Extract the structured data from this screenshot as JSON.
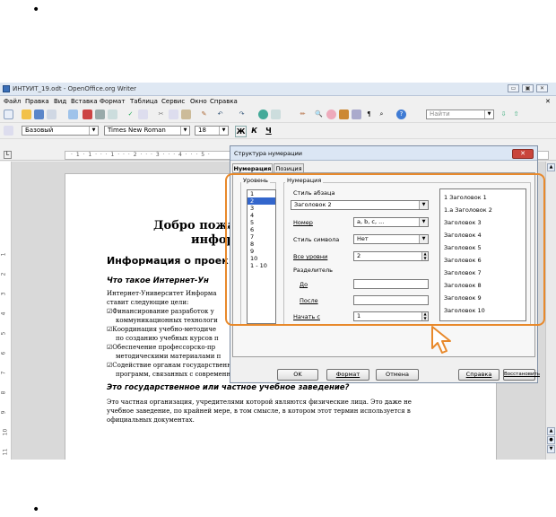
{
  "window": {
    "title": "ИНТУИТ_19.odt - OpenOffice.org Writer"
  },
  "menu": [
    "Файл",
    "Правка",
    "Вид",
    "Вставка",
    "Формат",
    "Таблица",
    "Сервис",
    "Окно",
    "Справка"
  ],
  "toolbar": {
    "style": "Базовый",
    "font": "Times New Roman",
    "size": "18",
    "find_placeholder": "Найти",
    "bold": "Ж",
    "italic": "К",
    "underline": "Ч"
  },
  "ruler": {
    "marks": "· 1 · 1 · · · 1 · · · 2 · · · 3 · · · 4 · · · 5 ·"
  },
  "vruler": [
    "1",
    "2",
    "3",
    "4",
    "5",
    "6",
    "7",
    "8",
    "9",
    "10",
    "11"
  ],
  "document": {
    "heading1": "Добро пожал",
    "heading1b": "инфор",
    "heading2": "Информация о проек",
    "heading3": "Что такое Интернет-Ун",
    "para1a": "Интернет-Университет Информа",
    "para1b": "ставит следующие цели:",
    "items": [
      "Финансирование разработок у",
      "коммуникационных технологи",
      "Координация учебно-методиче",
      "по созданию учебных курсов п",
      "Обеспечение профессорско-пр",
      "методическими материалами п"
    ],
    "item_full_a": "Содействие органам государственной власти в области развития образовательных",
    "item_full_b": "программ, связанных с современными информационными технологиями.",
    "heading4": "Это государственное или частное учебное заведение?",
    "para2a": "Это частная организация, учредителями которой являются физические лица. Это даже не",
    "para2b": "учебное заведение, по крайней мере, в том смысле, в котором этот термин используется в",
    "para2c": "официальных документах."
  },
  "dialog": {
    "title": "Структура нумерации",
    "tabs": [
      "Нумерация",
      "Позиция"
    ],
    "level_label": "Уровень",
    "numbering_label": "Нумерация",
    "levels": [
      "1",
      "2",
      "3",
      "4",
      "5",
      "6",
      "7",
      "8",
      "9",
      "10",
      "1 - 10"
    ],
    "selected_level": "2",
    "para_style_label": "Стиль абзаца",
    "para_style_value": "Заголовок 2",
    "number_label": "Номер",
    "number_value": "a, b, c, ...",
    "char_style_label": "Стиль символа",
    "char_style_value": "Нет",
    "all_levels_label": "Все уровни",
    "all_levels_value": "2",
    "separator_label": "Разделитель",
    "before_label": "До",
    "before_value": "",
    "after_label": "После",
    "after_value": "",
    "start_label": "Начать с",
    "start_value": "1",
    "preview": [
      "1 Заголовок 1",
      "1.a Заголовок 2",
      "Заголовок 3",
      "Заголовок 4",
      "Заголовок 5",
      "Заголовок 6",
      "Заголовок 7",
      "Заголовок 8",
      "Заголовок 9",
      "Заголовок 10"
    ],
    "buttons": {
      "ok": "OK",
      "format": "Формат",
      "cancel": "Отмена",
      "help": "Справка",
      "reset": "Восстановить"
    }
  },
  "colors": {
    "highlight": "#e8892b",
    "selection": "#3366cc",
    "close": "#c9453c"
  }
}
